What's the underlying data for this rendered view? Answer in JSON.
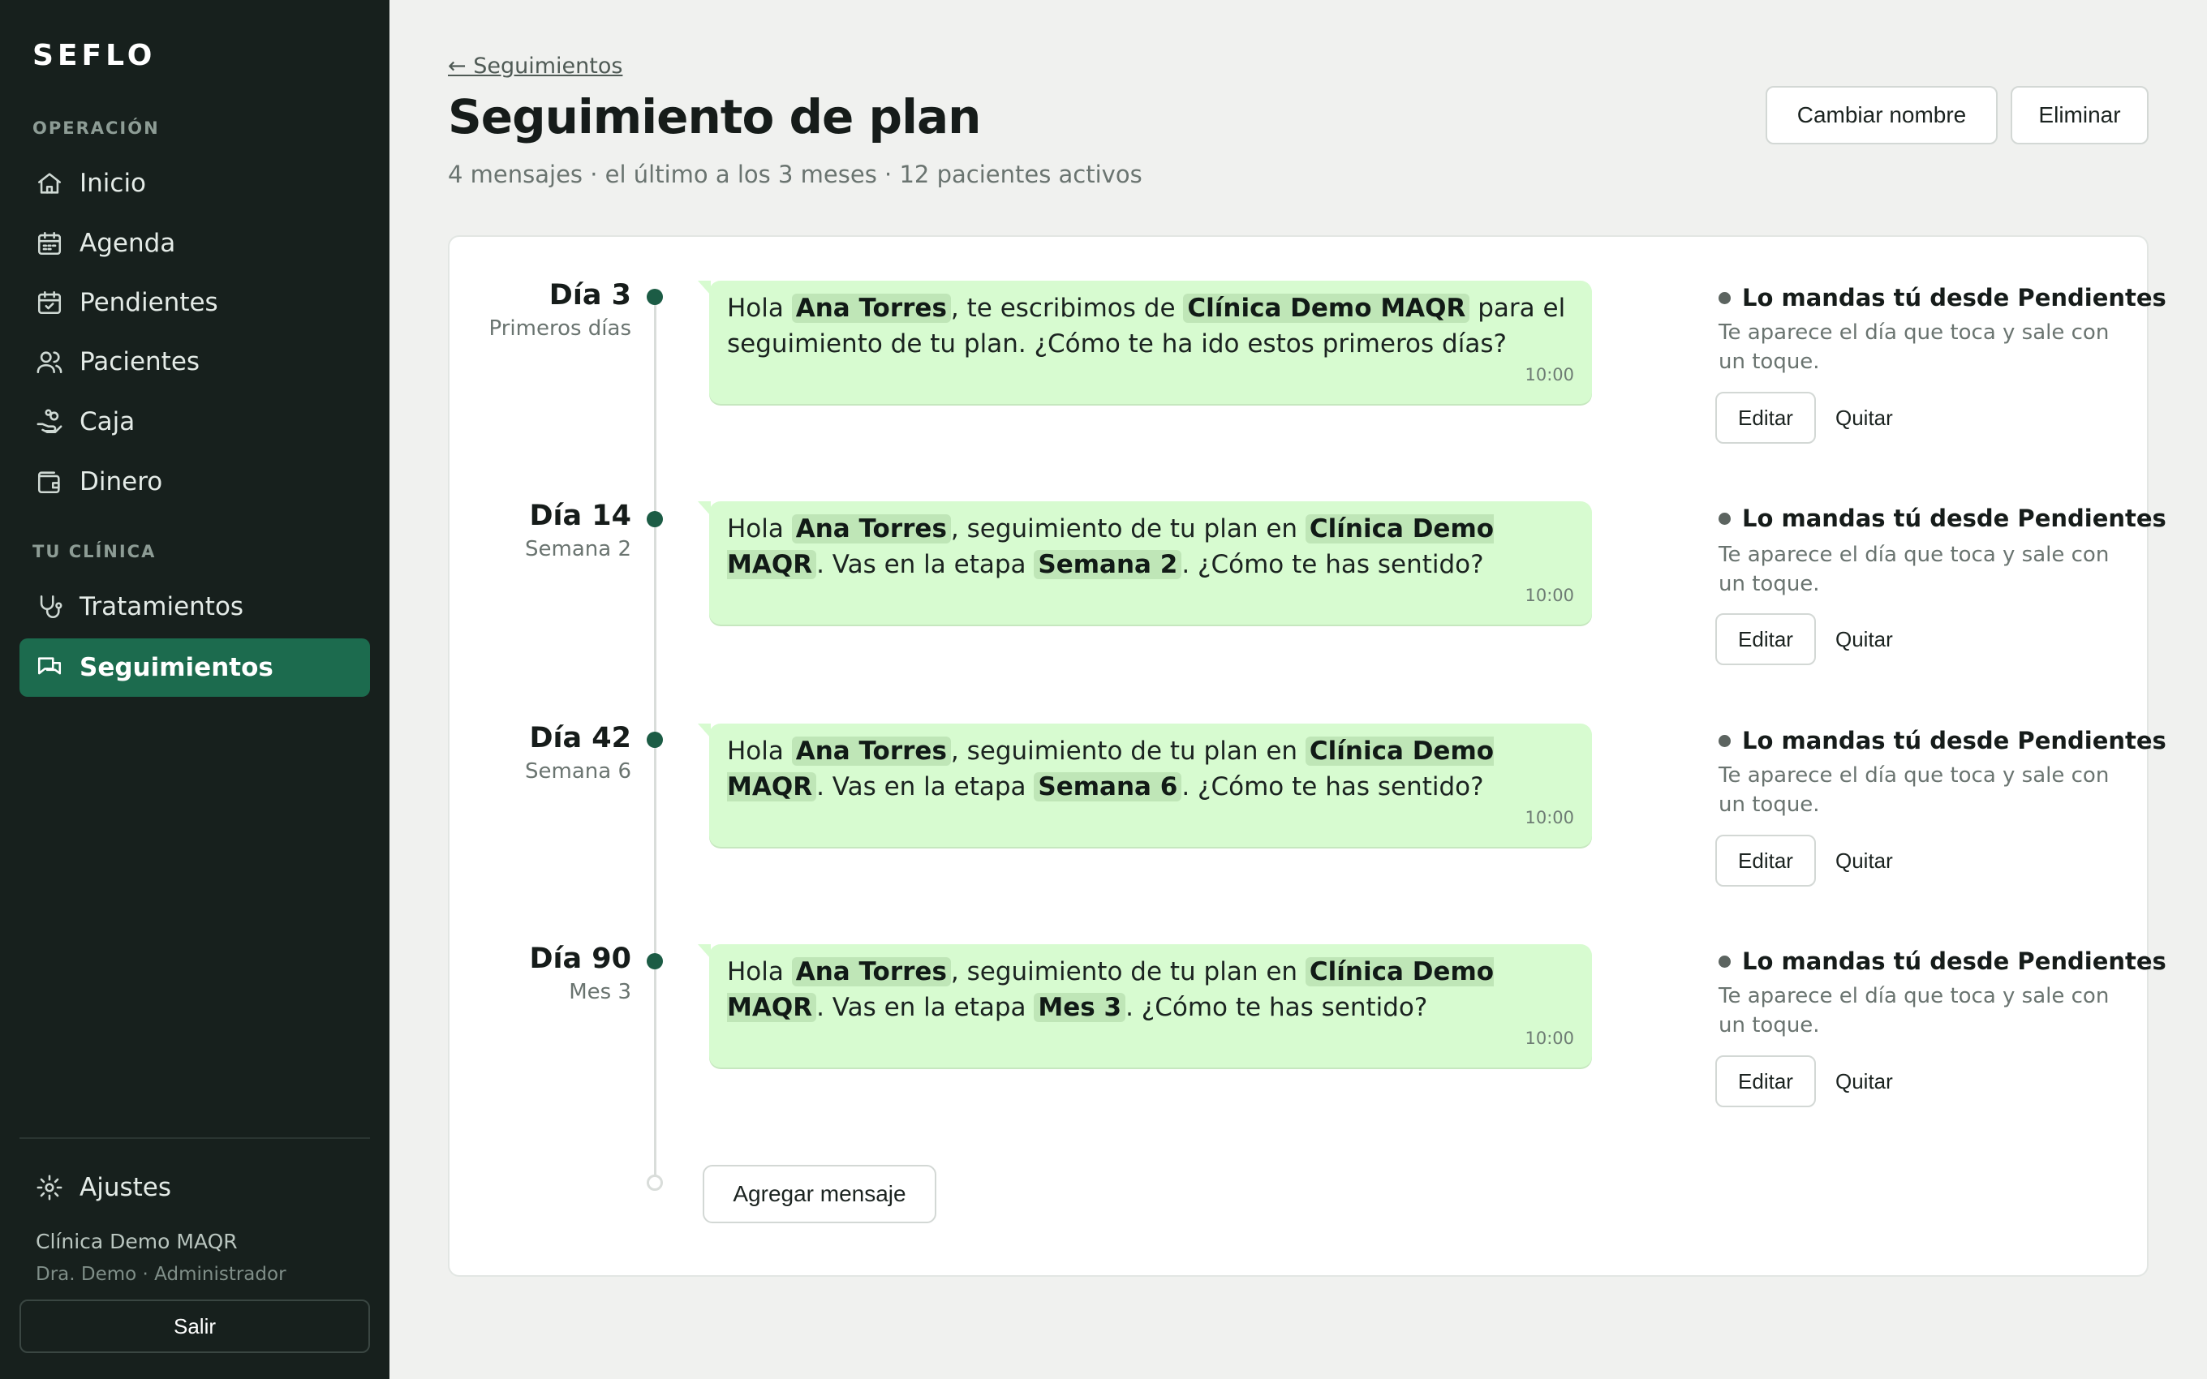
{
  "sidebar": {
    "brand": "SEFLO",
    "section_operacion": "OPERACIÓN",
    "section_clinica": "TU CLÍNICA",
    "items": [
      {
        "label": "Inicio",
        "icon": "home-icon"
      },
      {
        "label": "Agenda",
        "icon": "calendar-icon"
      },
      {
        "label": "Pendientes",
        "icon": "calendar-check-icon"
      },
      {
        "label": "Pacientes",
        "icon": "users-icon"
      },
      {
        "label": "Caja",
        "icon": "hand-coins-icon"
      },
      {
        "label": "Dinero",
        "icon": "wallet-icon"
      },
      {
        "label": "Tratamientos",
        "icon": "stethoscope-icon"
      },
      {
        "label": "Seguimientos",
        "icon": "messages-icon",
        "active": true
      }
    ],
    "settings_label": "Ajustes",
    "clinic_name": "Clínica Demo MAQR",
    "user_role": "Dra. Demo · Administrador",
    "logout_label": "Salir"
  },
  "header": {
    "back_link": "← Seguimientos",
    "title": "Seguimiento de plan",
    "subtitle": "4 mensajes · el último a los 3 meses · 12 pacientes activos",
    "rename_label": "Cambiar nombre",
    "delete_label": "Eliminar"
  },
  "messages": [
    {
      "day": "Día 3",
      "stage": "Primeros días",
      "parts": [
        "Hola ",
        "Ana Torres",
        ", te escribimos de ",
        "Clínica Demo MAQR",
        " para el seguimiento de tu plan. ¿Cómo te ha ido estos primeros días?"
      ],
      "time": "10:00",
      "mode_title": "Lo mandas tú desde Pendientes",
      "mode_desc": "Te aparece el día que toca y sale con un toque.",
      "edit_label": "Editar",
      "remove_label": "Quitar"
    },
    {
      "day": "Día 14",
      "stage": "Semana 2",
      "parts": [
        "Hola ",
        "Ana Torres",
        ", seguimiento de tu plan en ",
        "Clínica Demo MAQR",
        ". Vas en la etapa ",
        "Semana 2",
        ". ¿Cómo te has sentido?"
      ],
      "time": "10:00",
      "mode_title": "Lo mandas tú desde Pendientes",
      "mode_desc": "Te aparece el día que toca y sale con un toque.",
      "edit_label": "Editar",
      "remove_label": "Quitar"
    },
    {
      "day": "Día 42",
      "stage": "Semana 6",
      "parts": [
        "Hola ",
        "Ana Torres",
        ", seguimiento de tu plan en ",
        "Clínica Demo MAQR",
        ". Vas en la etapa ",
        "Semana 6",
        ". ¿Cómo te has sentido?"
      ],
      "time": "10:00",
      "mode_title": "Lo mandas tú desde Pendientes",
      "mode_desc": "Te aparece el día que toca y sale con un toque.",
      "edit_label": "Editar",
      "remove_label": "Quitar"
    },
    {
      "day": "Día 90",
      "stage": "Mes 3",
      "parts": [
        "Hola ",
        "Ana Torres",
        ", seguimiento de tu plan en ",
        "Clínica Demo MAQR",
        ". Vas en la etapa ",
        "Mes 3",
        ". ¿Cómo te has sentido?"
      ],
      "time": "10:00",
      "mode_title": "Lo mandas tú desde Pendientes",
      "mode_desc": "Te aparece el día que toca y sale con un toque.",
      "edit_label": "Editar",
      "remove_label": "Quitar"
    }
  ],
  "add_message_label": "Agregar mensaje",
  "colors": {
    "sidebar_bg": "#17201d",
    "accent": "#1c6b4e",
    "bubble_bg": "#d7fbd0",
    "tag_bg": "#bfe6b7",
    "page_bg": "#f0f1ef"
  }
}
